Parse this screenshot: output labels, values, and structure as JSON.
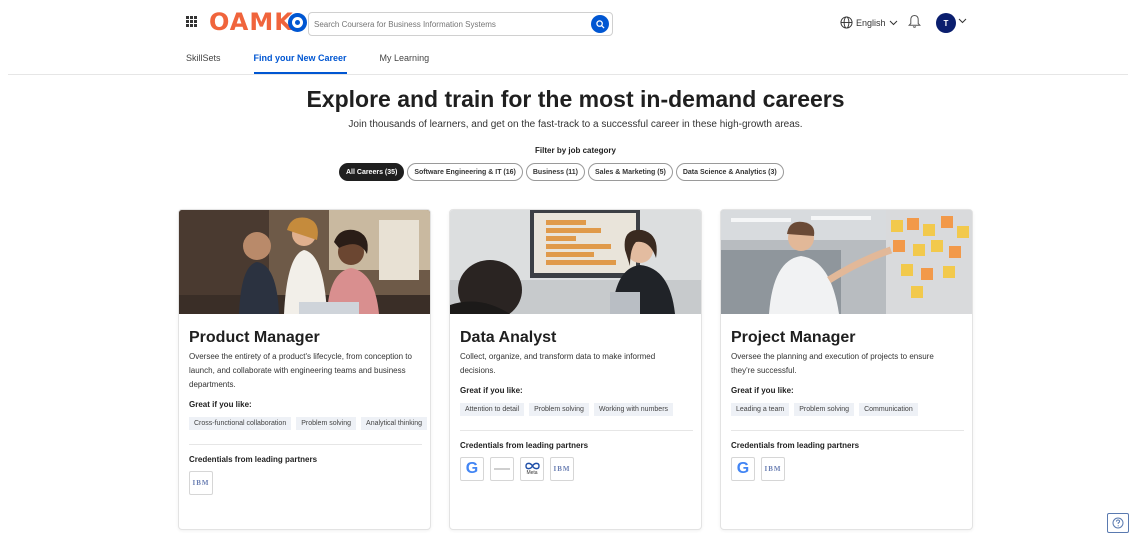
{
  "header": {
    "logo_text": "OAMK",
    "search_placeholder": "Search Coursera for Business Information Systems",
    "language": "English",
    "avatar_initial": "T",
    "brand_color": "#0056d2",
    "logo_color": "#f0643c"
  },
  "tabs": [
    {
      "label": "SkillSets",
      "active": false
    },
    {
      "label": "Find your New Career",
      "active": true
    },
    {
      "label": "My Learning",
      "active": false
    }
  ],
  "hero": {
    "title": "Explore and train for the most in-demand careers",
    "subtitle": "Join thousands of learners, and get on the fast-track to a successful career in these high-growth areas.",
    "filter_label": "Filter by job category"
  },
  "filters": [
    {
      "label": "All Careers (35)",
      "active": true
    },
    {
      "label": "Software Engineering & IT (16)",
      "active": false
    },
    {
      "label": "Business (11)",
      "active": false
    },
    {
      "label": "Sales & Marketing (5)",
      "active": false
    },
    {
      "label": "Data Science & Analytics (3)",
      "active": false
    }
  ],
  "cards": [
    {
      "title": "Product Manager",
      "description": "Oversee the entirety of a product's lifecycle, from conception to launch, and collaborate with engineering teams and business departments.",
      "like_heading": "Great if you like:",
      "tags": [
        "Cross-functional collaboration",
        "Problem solving",
        "Analytical thinking"
      ],
      "cred_heading": "Credentials from leading partners",
      "partners": [
        "ibm-logo"
      ]
    },
    {
      "title": "Data Analyst",
      "description": "Collect, organize, and transform data to make informed decisions.",
      "like_heading": "Great if you like:",
      "tags": [
        "Attention to detail",
        "Problem solving",
        "Working with numbers"
      ],
      "cred_heading": "Credentials from leading partners",
      "partners": [
        "google-logo",
        "partner-logo",
        "meta-logo",
        "ibm-logo"
      ],
      "meta_text": "Meta"
    },
    {
      "title": "Project Manager",
      "description": "Oversee the planning and execution of projects to ensure they're successful.",
      "like_heading": "Great if you like:",
      "tags": [
        "Leading a team",
        "Problem solving",
        "Communication"
      ],
      "cred_heading": "Credentials from leading partners",
      "partners": [
        "google-logo",
        "ibm-logo"
      ]
    }
  ],
  "logos": {
    "google": "G",
    "ibm": "IBM"
  }
}
